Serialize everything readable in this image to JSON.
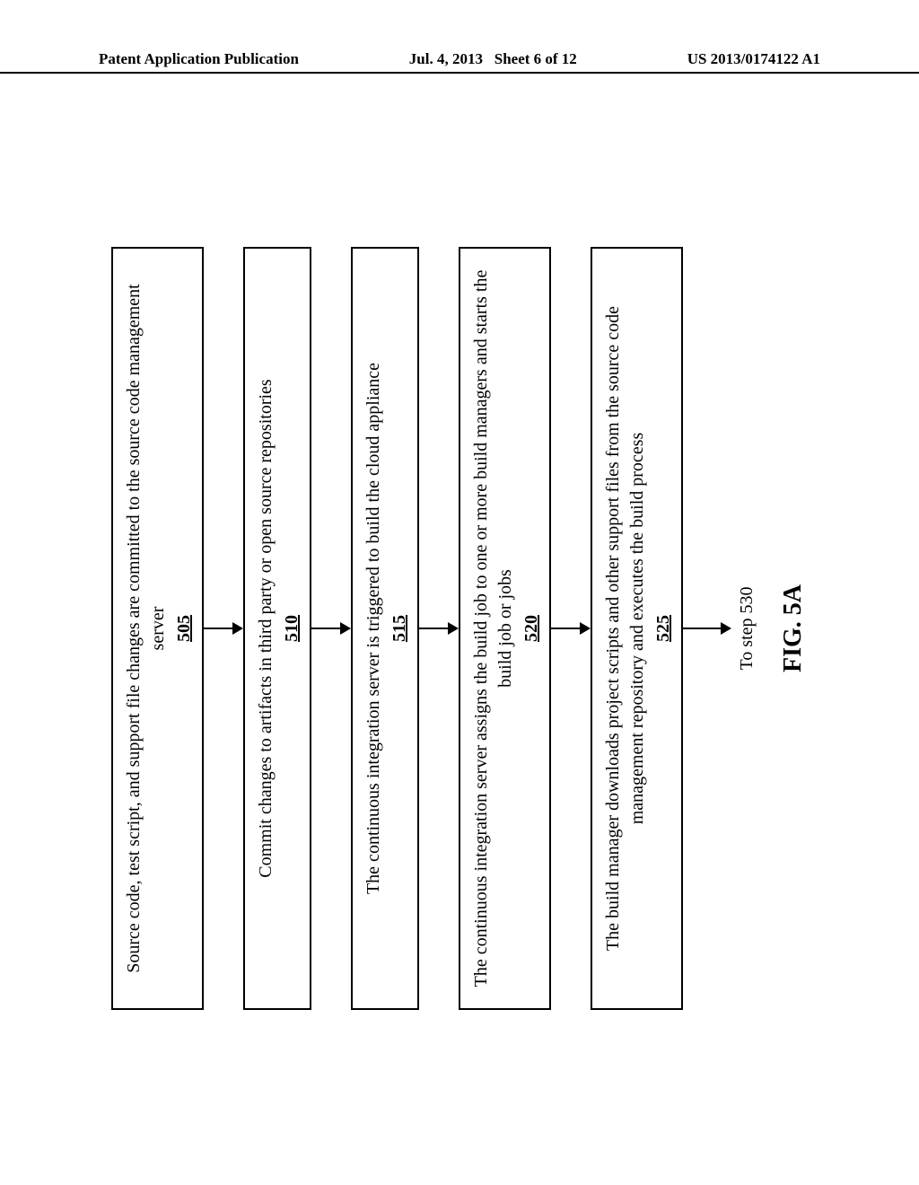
{
  "header": {
    "left": "Patent Application Publication",
    "center_date": "Jul. 4, 2013",
    "center_sheet": "Sheet 6 of 12",
    "right": "US 2013/0174122 A1"
  },
  "steps": [
    {
      "text": "Source code, test script, and support file changes are committed to the source code management server",
      "num": "505"
    },
    {
      "text": "Commit changes to artifacts in third party or open source repositories",
      "num": "510"
    },
    {
      "text": "The continuous integration server is triggered to build the cloud appliance",
      "num": "515"
    },
    {
      "text": "The continuous integration server assigns the build job to one or more build managers and starts the build job or jobs",
      "num": "520"
    },
    {
      "text": "The build manager downloads project scripts and other support files from the source code management repository and executes the build process",
      "num": "525"
    }
  ],
  "tail": "To step 530",
  "figure_label": "FIG. 5A"
}
